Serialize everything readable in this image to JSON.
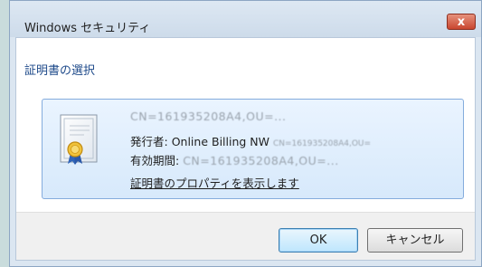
{
  "window": {
    "title": "Windows セキュリティ",
    "close_label": "x"
  },
  "dialog": {
    "heading": "証明書の選択",
    "certificate": {
      "subject": "CN=161935208A4,OU=...",
      "issuer_label": "発行者:",
      "issuer_value": "Online Billing NW",
      "issuer_extra": "CN=161935208A4,OU=",
      "validity_label": "有効期間:",
      "validity_value": "CN=161935208A4,OU=...",
      "properties_link": "証明書のプロパティを表示します",
      "icon": "certificate-icon"
    },
    "buttons": {
      "ok": "OK",
      "cancel": "キャンセル"
    }
  },
  "colors": {
    "heading": "#1e4a8a",
    "selection_bg": "#d7e9fb",
    "selection_border": "#84acdd",
    "close_button": "#c9462f"
  }
}
